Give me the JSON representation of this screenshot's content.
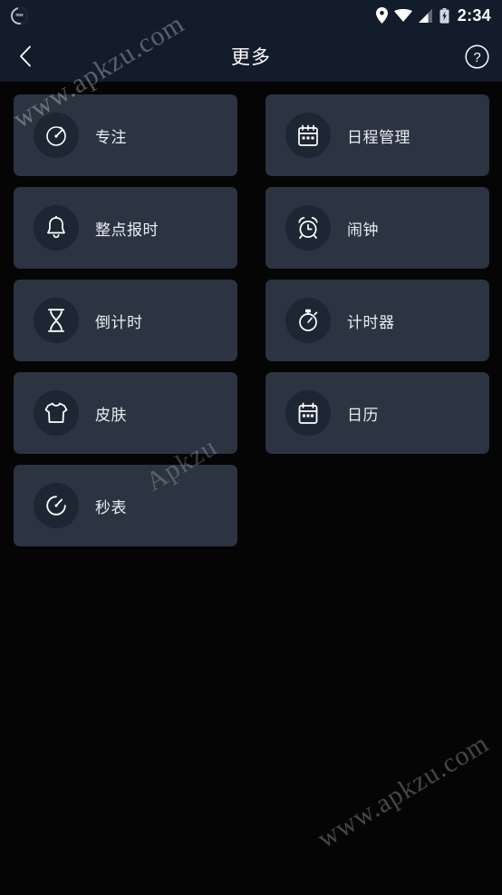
{
  "statusbar": {
    "notification_icon": "nox-logo-icon",
    "notification_label": "nox",
    "icons": [
      "location-pin-icon",
      "wifi-icon",
      "signal-bars-icon",
      "battery-charging-icon"
    ],
    "time": "2:34"
  },
  "header": {
    "back_icon": "chevron-left-icon",
    "title": "更多",
    "help_icon": "help-circle-icon"
  },
  "grid": {
    "rows": [
      [
        {
          "label": "专注",
          "icon": "focus-clock-icon"
        },
        {
          "label": "日程管理",
          "icon": "calendar-schedule-icon"
        }
      ],
      [
        {
          "label": "整点报时",
          "icon": "bell-icon"
        },
        {
          "label": "闹钟",
          "icon": "alarm-clock-icon"
        }
      ],
      [
        {
          "label": "倒计时",
          "icon": "hourglass-icon"
        },
        {
          "label": "计时器",
          "icon": "stopwatch-icon"
        }
      ],
      [
        {
          "label": "皮肤",
          "icon": "tshirt-skin-icon"
        },
        {
          "label": "日历",
          "icon": "calendar-icon"
        }
      ],
      [
        {
          "label": "秒表",
          "icon": "timer-dial-icon"
        }
      ]
    ]
  },
  "watermarks": [
    "www.apkzu.com",
    "Apkzu",
    "www.apkzu.com"
  ],
  "colors": {
    "page_background": "#050505",
    "chrome": "#131c2a",
    "card": "#2b3440",
    "icon_circle": "#1d2733",
    "text": "#e9edf1",
    "accent_white": "#ffffff"
  }
}
